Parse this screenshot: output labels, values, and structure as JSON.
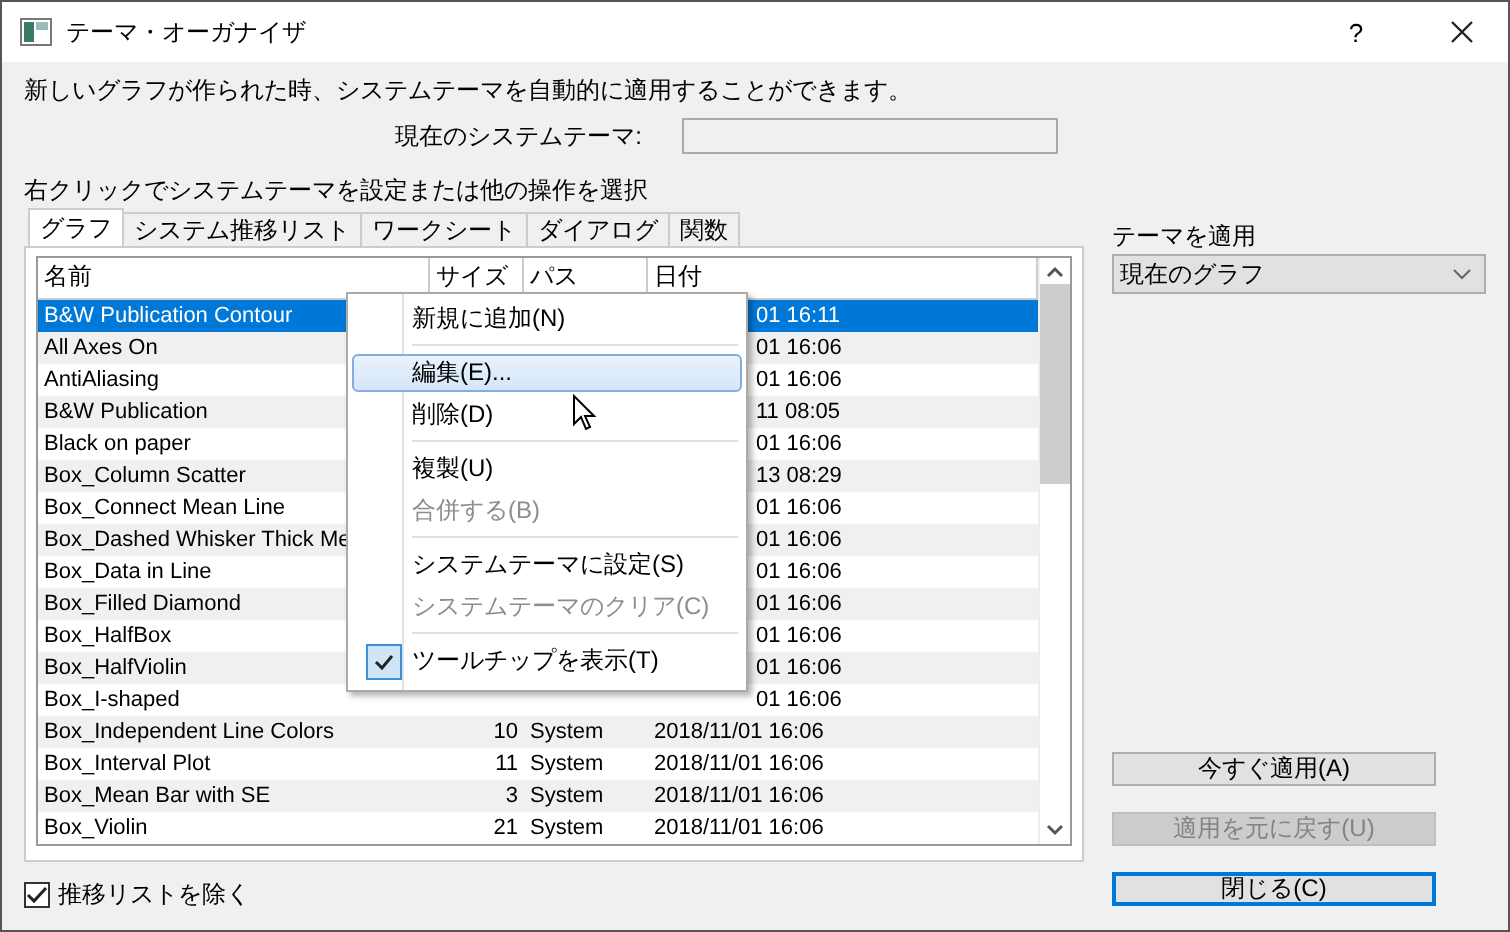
{
  "window": {
    "title": "テーマ・オーガナイザ",
    "help": "?"
  },
  "intro": "新しいグラフが作られた時、システムテーマを自動的に適用することができます。",
  "system_theme": {
    "label": "現在のシステムテーマ:"
  },
  "instruction": "右クリックでシステムテーマを設定または他の操作を選択",
  "tabs": [
    {
      "label": "グラフ",
      "selected": true
    },
    {
      "label": "システム推移リスト",
      "selected": false
    },
    {
      "label": "ワークシート",
      "selected": false
    },
    {
      "label": "ダイアログ",
      "selected": false
    },
    {
      "label": "関数",
      "selected": false
    }
  ],
  "table": {
    "columns": [
      "名前",
      "サイズ",
      "パス",
      "日付"
    ],
    "rows": [
      {
        "name": "B&W Publication Contour",
        "date": "01 16:11",
        "selected": true
      },
      {
        "name": "All Axes On",
        "date": "01 16:06",
        "selected": false
      },
      {
        "name": "AntiAliasing",
        "date": "01 16:06",
        "selected": false
      },
      {
        "name": "B&W Publication",
        "date": "11 08:05",
        "selected": false
      },
      {
        "name": "Black on paper",
        "date": "01 16:06",
        "selected": false
      },
      {
        "name": "Box_Column Scatter",
        "date": "13 08:29",
        "selected": false
      },
      {
        "name": "Box_Connect Mean Line",
        "date": "01 16:06",
        "selected": false
      },
      {
        "name": "Box_Dashed Whisker Thick Me",
        "date": "01 16:06",
        "selected": false
      },
      {
        "name": "Box_Data in Line",
        "date": "01 16:06",
        "selected": false
      },
      {
        "name": "Box_Filled Diamond",
        "date": "01 16:06",
        "selected": false
      },
      {
        "name": "Box_HalfBox",
        "date": "01 16:06",
        "selected": false
      },
      {
        "name": "Box_HalfViolin",
        "date": "01 16:06",
        "selected": false
      },
      {
        "name": "Box_I-shaped",
        "date": "01 16:06",
        "selected": false
      },
      {
        "name": "Box_Independent Line Colors",
        "size": "10",
        "path": "System",
        "date": "2018/11/01 16:06",
        "selected": false
      },
      {
        "name": "Box_Interval Plot",
        "size": "11",
        "path": "System",
        "date": "2018/11/01 16:06",
        "selected": false
      },
      {
        "name": "Box_Mean Bar with SE",
        "size": "3",
        "path": "System",
        "date": "2018/11/01 16:06",
        "selected": false
      },
      {
        "name": "Box_Violin",
        "size": "21",
        "path": "System",
        "date": "2018/11/01 16:06",
        "selected": false
      }
    ]
  },
  "context_menu": {
    "items": [
      {
        "kind": "item",
        "label": "新規に追加(N)",
        "selected": false,
        "disabled": false,
        "checked": false
      },
      {
        "kind": "separator"
      },
      {
        "kind": "item",
        "label": "編集(E)...",
        "selected": true,
        "disabled": false,
        "checked": false
      },
      {
        "kind": "item",
        "label": "削除(D)",
        "selected": false,
        "disabled": false,
        "checked": false
      },
      {
        "kind": "separator"
      },
      {
        "kind": "item",
        "label": "複製(U)",
        "selected": false,
        "disabled": false,
        "checked": false
      },
      {
        "kind": "item",
        "label": "合併する(B)",
        "selected": false,
        "disabled": true,
        "checked": false
      },
      {
        "kind": "separator"
      },
      {
        "kind": "item",
        "label": "システムテーマに設定(S)",
        "selected": false,
        "disabled": false,
        "checked": false
      },
      {
        "kind": "item",
        "label": "システムテーマのクリア(C)",
        "selected": false,
        "disabled": true,
        "checked": false
      },
      {
        "kind": "separator"
      },
      {
        "kind": "item",
        "label": "ツールチップを表示(T)",
        "selected": false,
        "disabled": false,
        "checked": true
      }
    ]
  },
  "apply_theme": {
    "label": "テーマを適用",
    "value": "現在のグラフ"
  },
  "buttons": [
    {
      "label": "今すぐ適用(A)",
      "disabled": false,
      "default": false
    },
    {
      "label": "適用を元に戻す(U)",
      "disabled": true,
      "default": false
    },
    {
      "label": "閉じる(C)",
      "disabled": false,
      "default": true
    }
  ],
  "exclude_history": {
    "label": "推移リストを除く",
    "checked": true
  }
}
